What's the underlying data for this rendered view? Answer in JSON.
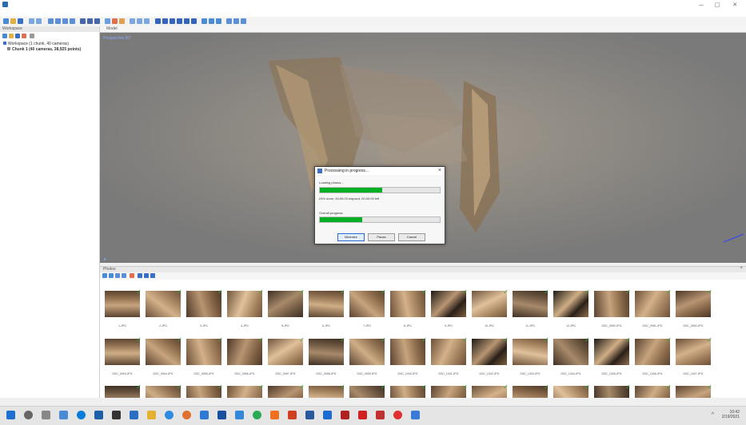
{
  "window": {
    "title": "",
    "minimize": "—",
    "maximize": "□",
    "close": "✕"
  },
  "menu": [
    "",
    "",
    "",
    "",
    "",
    "",
    ""
  ],
  "workspace": {
    "title": "Workspace",
    "tree": [
      "Workspace (1 chunk, 40 cameras)",
      "Chunk 1 (40 cameras, 38,925 points)"
    ]
  },
  "model_view": {
    "tab": "Model",
    "label": "Perspective 30°"
  },
  "dialog": {
    "title": "Processing in progress...",
    "step_label": "Loading photos...",
    "step_progress": 0.52,
    "status_text": "24% done, 00:00:03 elapsed, 00:00:09 left",
    "overall_label": "Overall progress:",
    "overall_progress": 0.35,
    "buttons": [
      "Minimize",
      "Pause",
      "Cancel"
    ]
  },
  "photos": {
    "title": "Photos",
    "rows": [
      [
        "1.JPG",
        "2.JPG",
        "3.JPG",
        "4.JPG",
        "5.JPG",
        "6.JPG",
        "7.JPG",
        "8.JPG",
        "9.JPG",
        "10.JPG",
        "11.JPG",
        "12.JPG",
        "DSC_0990.JPG",
        "DSC_0991.JPG",
        "DSC_0992.JPG"
      ],
      [
        "DSC_0993.JPG",
        "DSC_0994.JPG",
        "DSC_0995.JPG",
        "DSC_0996.JPG",
        "DSC_0997.JPG",
        "DSC_0998.JPG",
        "DSC_0999.JPG",
        "DSC_1000.JPG",
        "DSC_1001.JPG",
        "DSC_1002.JPG",
        "DSC_1003.JPG",
        "DSC_1004.JPG",
        "DSC_1005.JPG",
        "DSC_1006.JPG",
        "DSC_1007.JPG"
      ],
      [
        "",
        "",
        "",
        "",
        "",
        "",
        "",
        "",
        "",
        "",
        "",
        "",
        "",
        "",
        ""
      ]
    ]
  },
  "taskbar": {
    "time": "10:42",
    "date": "2/19/2021"
  },
  "colors": {
    "progress_green": "#06b025",
    "viewport_gray": "#7f7f7f",
    "check_green": "#23b03a"
  }
}
